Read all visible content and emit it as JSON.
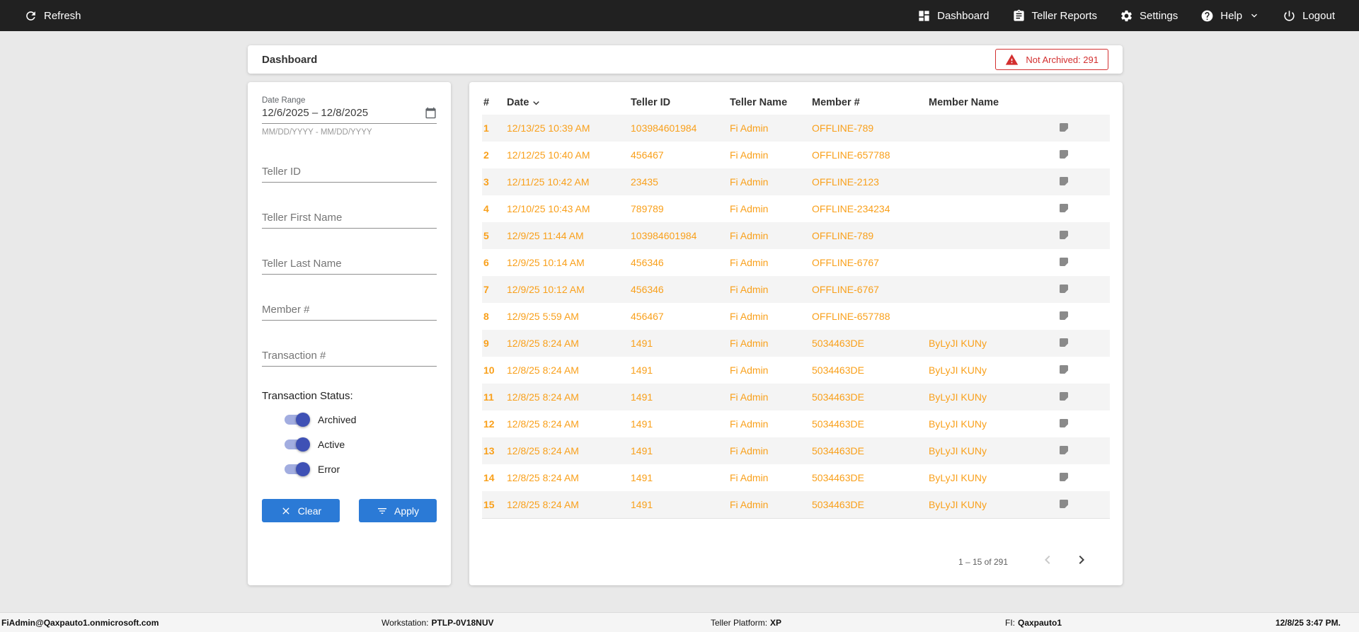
{
  "colors": {
    "topbar_bg": "#212121",
    "page_bg": "#e9e9e9",
    "accent_orange": "#f9a01b",
    "alert_red": "#d32f2f",
    "button_blue": "#2b7ad6",
    "toggle_blue": "#3f51b5"
  },
  "topbar": {
    "refresh_label": "Refresh",
    "nav": [
      {
        "label": "Dashboard",
        "icon": "dashboard-icon"
      },
      {
        "label": "Teller Reports",
        "icon": "clipboard-icon"
      },
      {
        "label": "Settings",
        "icon": "gear-icon"
      },
      {
        "label": "Help",
        "icon": "help-icon"
      },
      {
        "label": "Logout",
        "icon": "power-icon"
      }
    ]
  },
  "header": {
    "title": "Dashboard",
    "not_archived_badge": "Not Archived: 291"
  },
  "filters": {
    "date_range": {
      "label": "Date Range",
      "value": "12/6/2025 – 12/8/2025",
      "hint": "MM/DD/YYYY - MM/DD/YYYY"
    },
    "teller_id_placeholder": "Teller ID",
    "teller_first_name_placeholder": "Teller First Name",
    "teller_last_name_placeholder": "Teller Last Name",
    "member_num_placeholder": "Member #",
    "transaction_num_placeholder": "Transaction #",
    "status_label": "Transaction Status:",
    "toggles": [
      {
        "label": "Archived",
        "on": true
      },
      {
        "label": "Active",
        "on": true
      },
      {
        "label": "Error",
        "on": true
      }
    ],
    "clear_label": "Clear",
    "apply_label": "Apply"
  },
  "table": {
    "columns": [
      "#",
      "Date",
      "Teller ID",
      "Teller Name",
      "Member #",
      "Member Name"
    ],
    "rows": [
      {
        "num": "1",
        "date": "12/13/25 10:39 AM",
        "teller_id": "103984601984",
        "teller_name": "Fi Admin",
        "member_num": "OFFLINE-789",
        "member_name": ""
      },
      {
        "num": "2",
        "date": "12/12/25 10:40 AM",
        "teller_id": "456467",
        "teller_name": "Fi Admin",
        "member_num": "OFFLINE-657788",
        "member_name": ""
      },
      {
        "num": "3",
        "date": "12/11/25 10:42 AM",
        "teller_id": "23435",
        "teller_name": "Fi Admin",
        "member_num": "OFFLINE-2123",
        "member_name": ""
      },
      {
        "num": "4",
        "date": "12/10/25 10:43 AM",
        "teller_id": "789789",
        "teller_name": "Fi Admin",
        "member_num": "OFFLINE-234234",
        "member_name": ""
      },
      {
        "num": "5",
        "date": "12/9/25 11:44 AM",
        "teller_id": "103984601984",
        "teller_name": "Fi Admin",
        "member_num": "OFFLINE-789",
        "member_name": ""
      },
      {
        "num": "6",
        "date": "12/9/25 10:14 AM",
        "teller_id": "456346",
        "teller_name": "Fi Admin",
        "member_num": "OFFLINE-6767",
        "member_name": ""
      },
      {
        "num": "7",
        "date": "12/9/25 10:12 AM",
        "teller_id": "456346",
        "teller_name": "Fi Admin",
        "member_num": "OFFLINE-6767",
        "member_name": ""
      },
      {
        "num": "8",
        "date": "12/9/25 5:59 AM",
        "teller_id": "456467",
        "teller_name": "Fi Admin",
        "member_num": "OFFLINE-657788",
        "member_name": ""
      },
      {
        "num": "9",
        "date": "12/8/25 8:24 AM",
        "teller_id": "1491",
        "teller_name": "Fi Admin",
        "member_num": "5034463DE",
        "member_name": "ByLyJI KUNy"
      },
      {
        "num": "10",
        "date": "12/8/25 8:24 AM",
        "teller_id": "1491",
        "teller_name": "Fi Admin",
        "member_num": "5034463DE",
        "member_name": "ByLyJI KUNy"
      },
      {
        "num": "11",
        "date": "12/8/25 8:24 AM",
        "teller_id": "1491",
        "teller_name": "Fi Admin",
        "member_num": "5034463DE",
        "member_name": "ByLyJI KUNy"
      },
      {
        "num": "12",
        "date": "12/8/25 8:24 AM",
        "teller_id": "1491",
        "teller_name": "Fi Admin",
        "member_num": "5034463DE",
        "member_name": "ByLyJI KUNy"
      },
      {
        "num": "13",
        "date": "12/8/25 8:24 AM",
        "teller_id": "1491",
        "teller_name": "Fi Admin",
        "member_num": "5034463DE",
        "member_name": "ByLyJI KUNy"
      },
      {
        "num": "14",
        "date": "12/8/25 8:24 AM",
        "teller_id": "1491",
        "teller_name": "Fi Admin",
        "member_num": "5034463DE",
        "member_name": "ByLyJI KUNy"
      },
      {
        "num": "15",
        "date": "12/8/25 8:24 AM",
        "teller_id": "1491",
        "teller_name": "Fi Admin",
        "member_num": "5034463DE",
        "member_name": "ByLyJI KUNy"
      }
    ],
    "pagination": {
      "range_label": "1 – 15 of 291"
    }
  },
  "statusbar": {
    "user": "FiAdmin@Qaxpauto1.onmicrosoft.com",
    "workstation_label": "Workstation:",
    "workstation_value": "PTLP-0V18NUV",
    "platform_label": "Teller Platform:",
    "platform_value": "XP",
    "fi_label": "FI:",
    "fi_value": "Qaxpauto1",
    "timestamp": "12/8/25 3:47 PM."
  }
}
